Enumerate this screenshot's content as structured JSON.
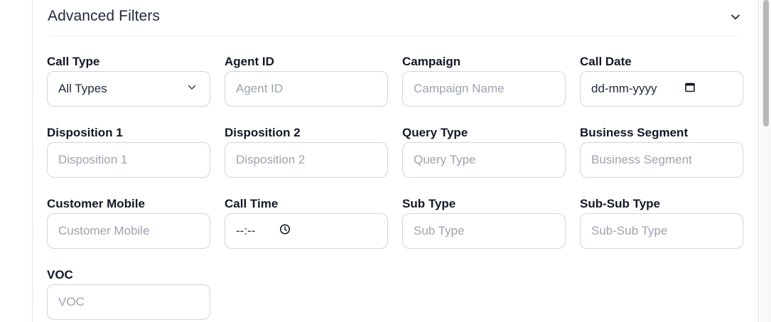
{
  "filters": {
    "title": "Advanced Filters",
    "fields": {
      "call_type": {
        "label": "Call Type",
        "value": "All Types"
      },
      "agent_id": {
        "label": "Agent ID",
        "placeholder": "Agent ID"
      },
      "campaign": {
        "label": "Campaign",
        "placeholder": "Campaign Name"
      },
      "call_date": {
        "label": "Call Date",
        "placeholder": "dd-mm-yyyy"
      },
      "disposition_1": {
        "label": "Disposition 1",
        "placeholder": "Disposition 1"
      },
      "disposition_2": {
        "label": "Disposition 2",
        "placeholder": "Disposition 2"
      },
      "query_type": {
        "label": "Query Type",
        "placeholder": "Query Type"
      },
      "business_segment": {
        "label": "Business Segment",
        "placeholder": "Business Segment"
      },
      "customer_mobile": {
        "label": "Customer Mobile",
        "placeholder": "Customer Mobile"
      },
      "call_time": {
        "label": "Call Time",
        "placeholder": "--:--"
      },
      "sub_type": {
        "label": "Sub Type",
        "placeholder": "Sub Type"
      },
      "sub_sub_type": {
        "label": "Sub-Sub Type",
        "placeholder": "Sub-Sub Type"
      },
      "voc": {
        "label": "VOC",
        "placeholder": "VOC"
      }
    }
  },
  "icons": {
    "collapse": "chevron-down-icon",
    "select": "chevron-down-icon",
    "date": "calendar-icon",
    "time": "clock-icon"
  },
  "colors": {
    "border": "#d1d5db",
    "placeholder": "#9ca3af",
    "text": "#111827"
  }
}
